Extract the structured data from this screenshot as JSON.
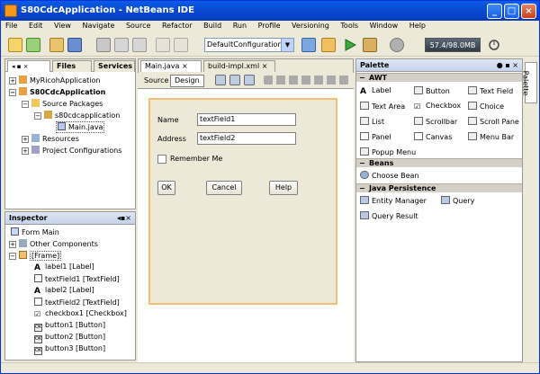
{
  "window": {
    "title": "S80CdcApplication - NetBeans IDE"
  },
  "menu": [
    "File",
    "Edit",
    "View",
    "Navigate",
    "Source",
    "Refactor",
    "Build",
    "Run",
    "Profile",
    "Versioning",
    "Tools",
    "Window",
    "Help"
  ],
  "toolbar": {
    "config": "DefaultConfiguration",
    "memory": "57.4/98.0MB"
  },
  "projects_panel": {
    "tabs": [
      "Files",
      "Services"
    ],
    "tree": [
      {
        "label": "MyRicohApplication"
      },
      {
        "label": "S80CdcApplication"
      },
      {
        "label": "Source Packages"
      },
      {
        "label": "s80cdcapplication"
      },
      {
        "label": "Main.java"
      },
      {
        "label": "Resources"
      },
      {
        "label": "Project Configurations"
      }
    ]
  },
  "inspector": {
    "title": "Inspector",
    "items": [
      {
        "label": "Form Main"
      },
      {
        "label": "Other Components"
      },
      {
        "label": "[Frame]"
      },
      {
        "label": "label1 [Label]"
      },
      {
        "label": "textField1 [TextField]"
      },
      {
        "label": "label2 [Label]"
      },
      {
        "label": "textField2 [TextField]"
      },
      {
        "label": "checkbox1 [Checkbox]"
      },
      {
        "label": "button1 [Button]"
      },
      {
        "label": "button2 [Button]"
      },
      {
        "label": "button3 [Button]"
      }
    ]
  },
  "editor": {
    "tabs": [
      "Main.java",
      "build-impl.xml"
    ],
    "modes": [
      "Source",
      "Design"
    ]
  },
  "form": {
    "name_label": "Name",
    "name_value": "textField1",
    "address_label": "Address",
    "address_value": "textField2",
    "remember_label": "Remember Me",
    "ok_label": "OK",
    "cancel_label": "Cancel",
    "help_label": "Help"
  },
  "palette": {
    "title": "Palette",
    "side_tab": "Palette",
    "awt_title": "AWT",
    "awt": [
      "Label",
      "Button",
      "Text Field",
      "Text Area",
      "Checkbox",
      "Choice",
      "List",
      "Scrollbar",
      "Scroll Pane",
      "Panel",
      "Canvas",
      "Menu Bar",
      "Popup Menu"
    ],
    "beans_title": "Beans",
    "beans": [
      "Choose Bean"
    ],
    "jp_title": "Java Persistence",
    "jp": [
      "Entity Manager",
      "Query",
      "Query Result"
    ]
  }
}
